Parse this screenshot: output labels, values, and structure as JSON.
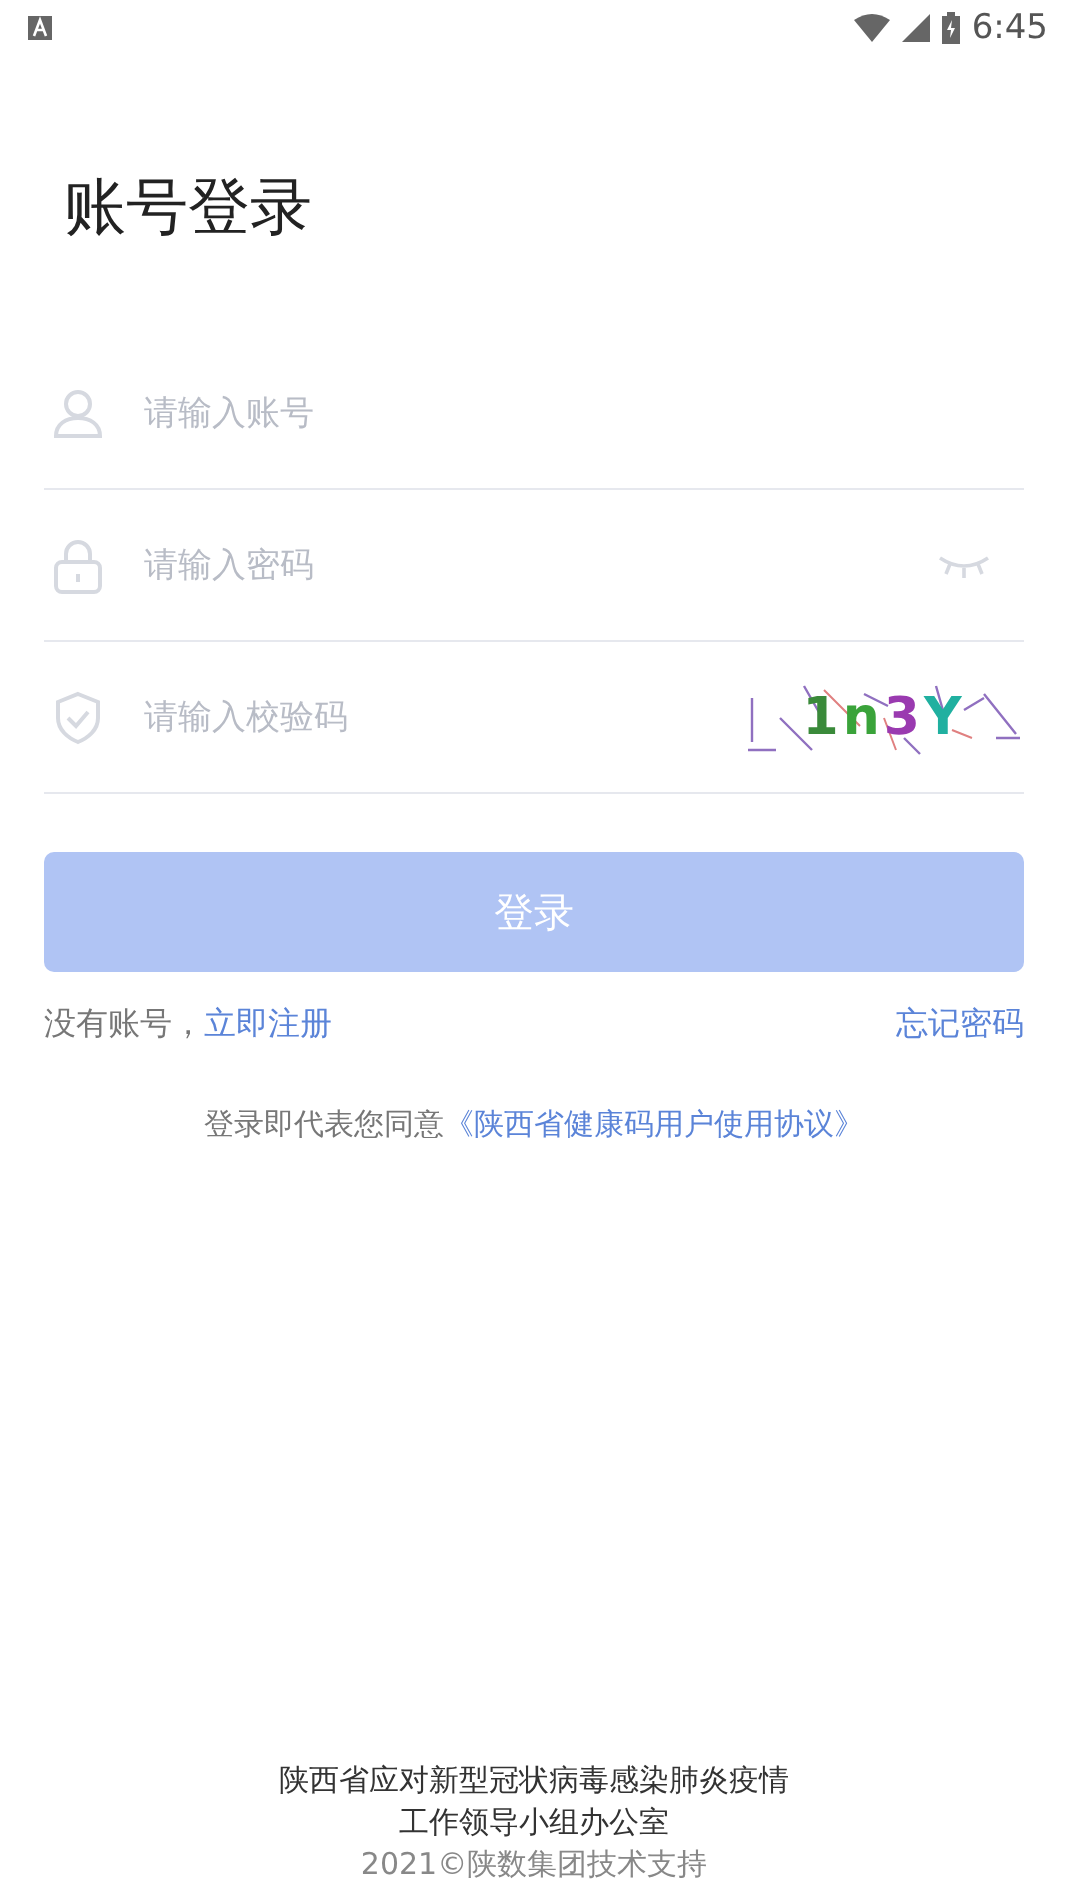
{
  "status_bar": {
    "time": "6:45"
  },
  "title": "账号登录",
  "fields": [
    {
      "kind": "account",
      "placeholder": "请输入账号"
    },
    {
      "kind": "password",
      "placeholder": "请输入密码"
    },
    {
      "kind": "captcha",
      "placeholder": "请输入校验码",
      "captcha": "1n3Y"
    }
  ],
  "login_button": {
    "label": "登录",
    "disabled": true
  },
  "register": {
    "prompt": "没有账号，",
    "link": "立即注册"
  },
  "forgot": "忘记密码",
  "agreement": {
    "text": "登录即代表您同意",
    "link": "《陕西省健康码用户使用协议》"
  },
  "footer": [
    "陕西省应对新型冠状病毒感染肺炎疫情",
    "工作领导小组办公室",
    "2021©陕数集团技术支持"
  ]
}
